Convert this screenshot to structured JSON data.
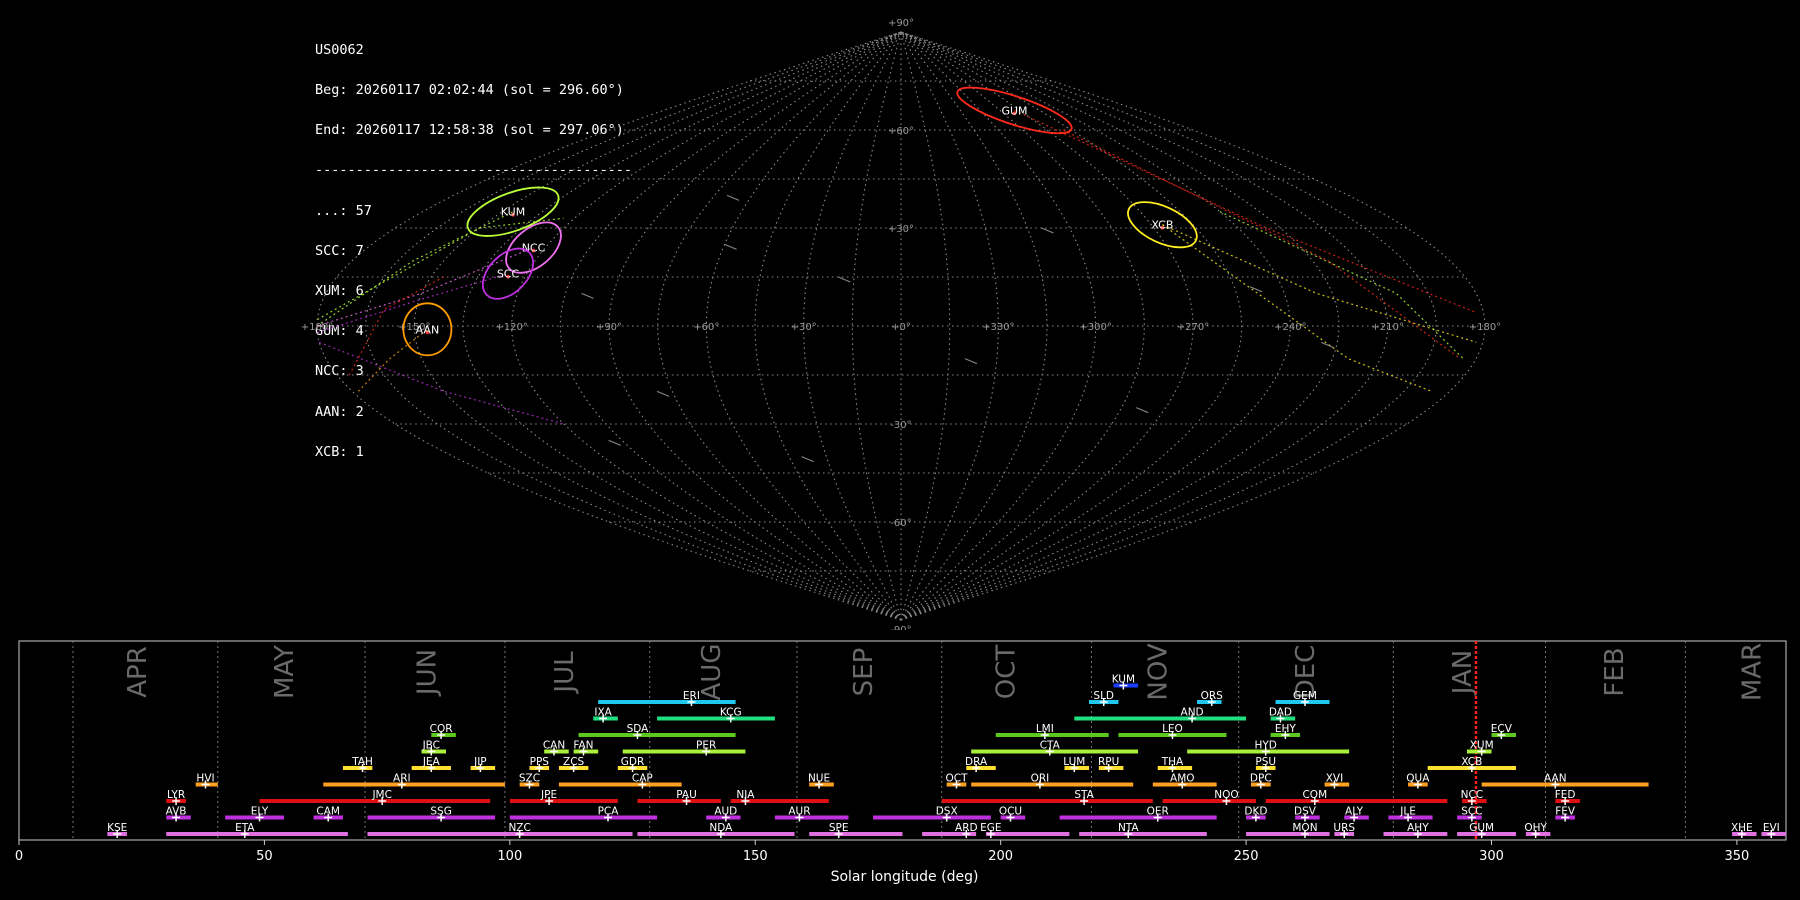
{
  "info": {
    "station": "US0062",
    "begin": "Beg: 20260117 02:02:44 (sol = 296.60°)",
    "end": "End: 20260117 12:58:38 (sol = 297.06°)",
    "separator": "---------------------------------------",
    "counts": [
      "...: 57",
      "SCC: 7",
      "XUM: 6",
      "GUM: 4",
      "NCC: 3",
      "AAN: 2",
      "XCB: 1"
    ]
  },
  "colors": {
    "grid": "#8a8a8a",
    "sporadic": "#888888",
    "timeline_border": "#cccccc",
    "current_sol_marker": "#ff2020"
  },
  "chart_data": [
    {
      "type": "scatter",
      "projection": "sinusoidal",
      "lon_ticks": [
        "+180°",
        "+150°",
        "+120°",
        "+90°",
        "+60°",
        "+30°",
        "+0°",
        "+330°",
        "+300°",
        "+270°",
        "+240°",
        "+210°",
        "+180°"
      ],
      "lat_ticks": [
        "+90°",
        "+60°",
        "+30°",
        "-30°",
        "-60°",
        "-90°"
      ],
      "lon_order": [
        180,
        150,
        120,
        90,
        60,
        30,
        0,
        330,
        300,
        270,
        240,
        210,
        180
      ],
      "grid": true,
      "radiants": [
        {
          "code": "KUM",
          "color": "#b9ff3a",
          "lon": 146,
          "lat": 35,
          "rx": 48,
          "ry": 19,
          "rot": -20
        },
        {
          "code": "NCC",
          "color": "#f070f0",
          "lon": 124,
          "lat": 24,
          "rx": 32,
          "ry": 19,
          "rot": -40
        },
        {
          "code": "SCC",
          "color": "#c030e0",
          "lon": 126,
          "lat": 16,
          "rx": 30,
          "ry": 19,
          "rot": -45
        },
        {
          "code": "AAN",
          "color": "#ff9d00",
          "lon": 146,
          "lat": -1,
          "rx": 24,
          "ry": 26,
          "rot": 0
        },
        {
          "code": "GUM",
          "color": "#ff2a1a",
          "lon": 274,
          "lat": 66,
          "rx": 60,
          "ry": 14,
          "rot": 18
        },
        {
          "code": "XCB",
          "color": "#ffee22",
          "lon": 266,
          "lat": 31,
          "rx": 37,
          "ry": 18,
          "rot": 25
        }
      ]
    },
    {
      "type": "bar",
      "subtype": "timeline",
      "xlabel": "Solar longitude (deg)",
      "xlim": [
        0,
        360
      ],
      "xticks": [
        0,
        50,
        100,
        150,
        200,
        250,
        300,
        350
      ],
      "current_sol": [
        296.6,
        297.06
      ],
      "months": [
        {
          "label": "APR",
          "start": 11,
          "mid": 24
        },
        {
          "label": "MAY",
          "start": 40.5,
          "mid": 54
        },
        {
          "label": "JUN",
          "start": 70.5,
          "mid": 83
        },
        {
          "label": "JUL",
          "start": 99,
          "mid": 111
        },
        {
          "label": "AUG",
          "start": 128.5,
          "mid": 141
        },
        {
          "label": "SEP",
          "start": 158.5,
          "mid": 172
        },
        {
          "label": "OCT",
          "start": 188,
          "mid": 201
        },
        {
          "label": "NOV",
          "start": 218.5,
          "mid": 232
        },
        {
          "label": "DEC",
          "start": 248.5,
          "mid": 262
        },
        {
          "label": "JAN",
          "start": 280,
          "mid": 294
        },
        {
          "label": "FEB",
          "start": 311,
          "mid": 325
        },
        {
          "label": "MAR",
          "start": 339.5,
          "mid": 353
        }
      ],
      "showers": [
        {
          "code": "KUM",
          "start": 223,
          "end": 228,
          "peak": 225,
          "row": 10,
          "color": "#1a3dff"
        },
        {
          "code": "ERI",
          "start": 118,
          "end": 146,
          "peak": 137,
          "row": 9,
          "color": "#20c8f0"
        },
        {
          "code": "SLD",
          "start": 218,
          "end": 224,
          "peak": 221,
          "row": 9,
          "color": "#20c8f0"
        },
        {
          "code": "ORS",
          "start": 240,
          "end": 245,
          "peak": 243,
          "row": 9,
          "color": "#20c8f0"
        },
        {
          "code": "GEM",
          "start": 256,
          "end": 267,
          "peak": 262,
          "row": 9,
          "color": "#20c8f0"
        },
        {
          "code": "IXA",
          "start": 117,
          "end": 122,
          "peak": 119,
          "row": 8,
          "color": "#20e080"
        },
        {
          "code": "KCG",
          "start": 130,
          "end": 154,
          "peak": 145,
          "row": 8,
          "color": "#20e080"
        },
        {
          "code": "AND",
          "start": 215,
          "end": 250,
          "peak": 239,
          "row": 8,
          "color": "#20e080"
        },
        {
          "code": "DAD",
          "start": 255,
          "end": 260,
          "peak": 257,
          "row": 8,
          "color": "#20e080"
        },
        {
          "code": "COR",
          "start": 84,
          "end": 89,
          "peak": 86,
          "row": 7,
          "color": "#5dc81e"
        },
        {
          "code": "SDA",
          "start": 114,
          "end": 146,
          "peak": 126,
          "row": 7,
          "color": "#5dc81e"
        },
        {
          "code": "LMI",
          "start": 199,
          "end": 222,
          "peak": 209,
          "row": 7,
          "color": "#5dc81e"
        },
        {
          "code": "LEO",
          "start": 224,
          "end": 246,
          "peak": 235,
          "row": 7,
          "color": "#5dc81e"
        },
        {
          "code": "EHY",
          "start": 255,
          "end": 261,
          "peak": 258,
          "row": 7,
          "color": "#5dc81e"
        },
        {
          "code": "ECV",
          "start": 300,
          "end": 305,
          "peak": 302,
          "row": 7,
          "color": "#5dc81e"
        },
        {
          "code": "JBC",
          "start": 82,
          "end": 87,
          "peak": 84,
          "row": 6,
          "color": "#a8f03a"
        },
        {
          "code": "CAN",
          "start": 107,
          "end": 112,
          "peak": 109,
          "row": 6,
          "color": "#a8f03a"
        },
        {
          "code": "FAN",
          "start": 113,
          "end": 118,
          "peak": 115,
          "row": 6,
          "color": "#a8f03a"
        },
        {
          "code": "PER",
          "start": 123,
          "end": 148,
          "peak": 140,
          "row": 6,
          "color": "#a8f03a"
        },
        {
          "code": "CTA",
          "start": 194,
          "end": 228,
          "peak": 210,
          "row": 6,
          "color": "#a8f03a"
        },
        {
          "code": "HYD",
          "start": 238,
          "end": 271,
          "peak": 254,
          "row": 6,
          "color": "#a8f03a"
        },
        {
          "code": "XUM",
          "start": 295,
          "end": 300,
          "peak": 298,
          "row": 6,
          "color": "#a8f03a"
        },
        {
          "code": "TAH",
          "start": 66,
          "end": 72,
          "peak": 70,
          "row": 5,
          "color": "#ffe030"
        },
        {
          "code": "JEA",
          "start": 80,
          "end": 88,
          "peak": 84,
          "row": 5,
          "color": "#ffe030"
        },
        {
          "code": "JIP",
          "start": 92,
          "end": 97,
          "peak": 94,
          "row": 5,
          "color": "#ffe030"
        },
        {
          "code": "PPS",
          "start": 104,
          "end": 108,
          "peak": 106,
          "row": 5,
          "color": "#ffe030"
        },
        {
          "code": "ZCS",
          "start": 110,
          "end": 116,
          "peak": 113,
          "row": 5,
          "color": "#ffe030"
        },
        {
          "code": "GDR",
          "start": 122,
          "end": 128,
          "peak": 125,
          "row": 5,
          "color": "#ffe030"
        },
        {
          "code": "DRA",
          "start": 193,
          "end": 199,
          "peak": 195,
          "row": 5,
          "color": "#ffe030"
        },
        {
          "code": "LUM",
          "start": 213,
          "end": 218,
          "peak": 215,
          "row": 5,
          "color": "#ffe030"
        },
        {
          "code": "RPU",
          "start": 220,
          "end": 225,
          "peak": 222,
          "row": 5,
          "color": "#ffe030"
        },
        {
          "code": "THA",
          "start": 232,
          "end": 239,
          "peak": 235,
          "row": 5,
          "color": "#ffe030"
        },
        {
          "code": "PSU",
          "start": 252,
          "end": 256,
          "peak": 254,
          "row": 5,
          "color": "#ffe030"
        },
        {
          "code": "XCB",
          "start": 287,
          "end": 305,
          "peak": 296,
          "row": 5,
          "color": "#ffe030"
        },
        {
          "code": "HVI",
          "start": 36,
          "end": 40.5,
          "peak": 38,
          "row": 4,
          "color": "#ffa020"
        },
        {
          "code": "ARI",
          "start": 62,
          "end": 99,
          "peak": 78,
          "row": 4,
          "color": "#ffa020"
        },
        {
          "code": "SZC",
          "start": 102,
          "end": 106,
          "peak": 104,
          "row": 4,
          "color": "#ffa020"
        },
        {
          "code": "CAP",
          "start": 110,
          "end": 135,
          "peak": 127,
          "row": 4,
          "color": "#ffa020"
        },
        {
          "code": "NUE",
          "start": 161,
          "end": 166,
          "peak": 163,
          "row": 4,
          "color": "#ffa020"
        },
        {
          "code": "OCT",
          "start": 189,
          "end": 193,
          "peak": 191,
          "row": 4,
          "color": "#ffa020"
        },
        {
          "code": "ORI",
          "start": 194,
          "end": 227,
          "peak": 208,
          "row": 4,
          "color": "#ffa020"
        },
        {
          "code": "AMO",
          "start": 231,
          "end": 244,
          "peak": 237,
          "row": 4,
          "color": "#ffa020"
        },
        {
          "code": "DPC",
          "start": 251,
          "end": 255,
          "peak": 253,
          "row": 4,
          "color": "#ffa020"
        },
        {
          "code": "XVI",
          "start": 266,
          "end": 271,
          "peak": 268,
          "row": 4,
          "color": "#ffa020"
        },
        {
          "code": "QUA",
          "start": 283,
          "end": 287,
          "peak": 285,
          "row": 4,
          "color": "#ffa020"
        },
        {
          "code": "AAN",
          "start": 298,
          "end": 332,
          "peak": 313,
          "row": 4,
          "color": "#ffa020"
        },
        {
          "code": "LYR",
          "start": 30,
          "end": 34,
          "peak": 32,
          "row": 3,
          "color": "#e01010"
        },
        {
          "code": "JMC",
          "start": 49,
          "end": 96,
          "peak": 74,
          "row": 3,
          "color": "#e01010"
        },
        {
          "code": "JPE",
          "start": 100,
          "end": 122,
          "peak": 108,
          "row": 3,
          "color": "#e01010"
        },
        {
          "code": "PAU",
          "start": 126,
          "end": 143,
          "peak": 136,
          "row": 3,
          "color": "#e01010"
        },
        {
          "code": "NIA",
          "start": 145,
          "end": 165,
          "peak": 148,
          "row": 3,
          "color": "#e01010"
        },
        {
          "code": "STA",
          "start": 188,
          "end": 231,
          "peak": 217,
          "row": 3,
          "color": "#e01010"
        },
        {
          "code": "NOO",
          "start": 233,
          "end": 252,
          "peak": 246,
          "row": 3,
          "color": "#e01010"
        },
        {
          "code": "COM",
          "start": 254,
          "end": 291,
          "peak": 264,
          "row": 3,
          "color": "#e01010"
        },
        {
          "code": "NCC",
          "start": 294,
          "end": 299,
          "peak": 296,
          "row": 3,
          "color": "#e01010"
        },
        {
          "code": "FED",
          "start": 313,
          "end": 318,
          "peak": 315,
          "row": 3,
          "color": "#e01010"
        },
        {
          "code": "AVB",
          "start": 30,
          "end": 35,
          "peak": 32,
          "row": 2,
          "color": "#c030e0"
        },
        {
          "code": "ELY",
          "start": 42,
          "end": 54,
          "peak": 49,
          "row": 2,
          "color": "#c030e0"
        },
        {
          "code": "CAM",
          "start": 60,
          "end": 66,
          "peak": 63,
          "row": 2,
          "color": "#c030e0"
        },
        {
          "code": "SSG",
          "start": 71,
          "end": 97,
          "peak": 86,
          "row": 2,
          "color": "#c030e0"
        },
        {
          "code": "PCA",
          "start": 100,
          "end": 130,
          "peak": 120,
          "row": 2,
          "color": "#c030e0"
        },
        {
          "code": "AUD",
          "start": 140,
          "end": 147,
          "peak": 144,
          "row": 2,
          "color": "#c030e0"
        },
        {
          "code": "AUR",
          "start": 154,
          "end": 169,
          "peak": 159,
          "row": 2,
          "color": "#c030e0"
        },
        {
          "code": "DSX",
          "start": 174,
          "end": 198,
          "peak": 189,
          "row": 2,
          "color": "#c030e0"
        },
        {
          "code": "OCU",
          "start": 200,
          "end": 205,
          "peak": 202,
          "row": 2,
          "color": "#c030e0"
        },
        {
          "code": "OER",
          "start": 212,
          "end": 244,
          "peak": 232,
          "row": 2,
          "color": "#c030e0"
        },
        {
          "code": "DKD",
          "start": 250,
          "end": 254,
          "peak": 252,
          "row": 2,
          "color": "#c030e0"
        },
        {
          "code": "DSV",
          "start": 260,
          "end": 265,
          "peak": 262,
          "row": 2,
          "color": "#c030e0"
        },
        {
          "code": "ALY",
          "start": 270,
          "end": 275,
          "peak": 272,
          "row": 2,
          "color": "#c030e0"
        },
        {
          "code": "JLE",
          "start": 279,
          "end": 288,
          "peak": 283,
          "row": 2,
          "color": "#c030e0"
        },
        {
          "code": "SCC",
          "start": 293,
          "end": 298,
          "peak": 296,
          "row": 2,
          "color": "#c030e0"
        },
        {
          "code": "FEV",
          "start": 313,
          "end": 317,
          "peak": 315,
          "row": 2,
          "color": "#c030e0"
        },
        {
          "code": "KSE",
          "start": 18,
          "end": 22,
          "peak": 20,
          "row": 1,
          "color": "#e070e0"
        },
        {
          "code": "ETA",
          "start": 30,
          "end": 67,
          "peak": 46,
          "row": 1,
          "color": "#e070e0"
        },
        {
          "code": "NZC",
          "start": 71,
          "end": 125,
          "peak": 102,
          "row": 1,
          "color": "#e070e0"
        },
        {
          "code": "NDA",
          "start": 126,
          "end": 158,
          "peak": 143,
          "row": 1,
          "color": "#e070e0"
        },
        {
          "code": "SPE",
          "start": 161,
          "end": 180,
          "peak": 167,
          "row": 1,
          "color": "#e070e0"
        },
        {
          "code": "ARD",
          "start": 184,
          "end": 195,
          "peak": 193,
          "row": 1,
          "color": "#e070e0"
        },
        {
          "code": "EGE",
          "start": 197,
          "end": 214,
          "peak": 198,
          "row": 1,
          "color": "#e070e0"
        },
        {
          "code": "NTA",
          "start": 216,
          "end": 242,
          "peak": 226,
          "row": 1,
          "color": "#e070e0"
        },
        {
          "code": "MON",
          "start": 250,
          "end": 267,
          "peak": 262,
          "row": 1,
          "color": "#e070e0"
        },
        {
          "code": "URS",
          "start": 268,
          "end": 272,
          "peak": 270,
          "row": 1,
          "color": "#e070e0"
        },
        {
          "code": "AHY",
          "start": 278,
          "end": 291,
          "peak": 285,
          "row": 1,
          "color": "#e070e0"
        },
        {
          "code": "GUM",
          "start": 293,
          "end": 305,
          "peak": 298,
          "row": 1,
          "color": "#e070e0"
        },
        {
          "code": "OHY",
          "start": 307,
          "end": 312,
          "peak": 309,
          "row": 1,
          "color": "#e070e0"
        },
        {
          "code": "XHE",
          "start": 349,
          "end": 354,
          "peak": 351,
          "row": 1,
          "color": "#e070e0"
        },
        {
          "code": "EVI",
          "start": 355,
          "end": 360,
          "peak": 357,
          "row": 1,
          "color": "#e070e0"
        }
      ]
    }
  ]
}
